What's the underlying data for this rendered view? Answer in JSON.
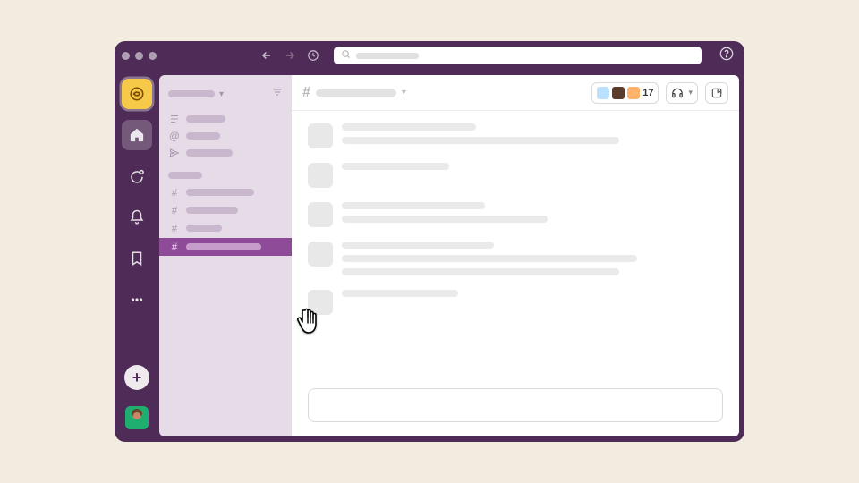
{
  "colors": {
    "brand": "#4F2B57",
    "accent": "#8E4B97",
    "workspace": "#F7C948"
  },
  "rail": {
    "workspace_icon": "swirl-icon",
    "items": [
      {
        "name": "home-icon",
        "active": true
      },
      {
        "name": "dm-icon",
        "active": false
      },
      {
        "name": "notifications-icon",
        "active": false
      },
      {
        "name": "bookmark-icon",
        "active": false
      },
      {
        "name": "more-icon",
        "active": false
      }
    ],
    "add_label": "+"
  },
  "sidebar": {
    "workspace_label": "",
    "nav": [
      {
        "icon": "threads-icon",
        "label_width": 44
      },
      {
        "icon": "mentions-icon",
        "label_width": 38
      },
      {
        "icon": "drafts-icon",
        "label_width": 52
      }
    ],
    "section_label": "",
    "channels": [
      {
        "label_width": 76,
        "selected": false
      },
      {
        "label_width": 58,
        "selected": false
      },
      {
        "label_width": 40,
        "selected": false
      },
      {
        "label_width": 84,
        "selected": true
      }
    ]
  },
  "channel": {
    "prefix": "#",
    "name": "",
    "member_count": "17",
    "avatars": [
      "a1",
      "a2",
      "a3"
    ]
  },
  "messages": [
    {
      "lines": [
        150,
        310
      ]
    },
    {
      "lines": [
        120
      ]
    },
    {
      "lines": [
        160,
        230
      ]
    },
    {
      "lines": [
        170,
        330,
        310
      ]
    },
    {
      "lines": [
        130
      ]
    }
  ],
  "composer": {
    "placeholder": ""
  },
  "search": {
    "placeholder": ""
  }
}
